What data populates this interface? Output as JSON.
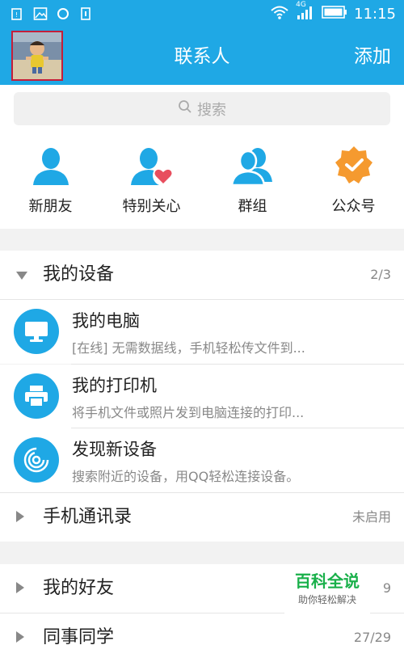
{
  "status_bar": {
    "time": "11:15",
    "network": "4G"
  },
  "header": {
    "title": "联系人",
    "add_label": "添加"
  },
  "search": {
    "placeholder": "搜索"
  },
  "shortcuts": [
    {
      "label": "新朋友",
      "icon": "person-icon"
    },
    {
      "label": "特别关心",
      "icon": "person-heart-icon"
    },
    {
      "label": "群组",
      "icon": "group-icon"
    },
    {
      "label": "公众号",
      "icon": "verified-badge-icon"
    }
  ],
  "groups": {
    "my_devices": {
      "name": "我的设备",
      "count": "2/3"
    },
    "phone_contacts": {
      "name": "手机通讯录",
      "count": "未启用"
    },
    "my_friends": {
      "name": "我的好友",
      "count": "9"
    },
    "colleagues": {
      "name": "同事同学",
      "count": "27/29"
    }
  },
  "devices": [
    {
      "name": "我的电脑",
      "desc": "[在线] 无需数据线，手机轻松传文件到...",
      "icon": "monitor-icon"
    },
    {
      "name": "我的打印机",
      "desc": "将手机文件或照片发到电脑连接的打印...",
      "icon": "printer-icon"
    },
    {
      "name": "发现新设备",
      "desc": "搜索附近的设备，用QQ轻松连接设备。",
      "icon": "radar-icon"
    }
  ],
  "watermark": {
    "title": "百科全说",
    "subtitle": "助你轻松解决"
  },
  "colors": {
    "primary": "#1fa8e5",
    "badge_orange": "#f59a2f",
    "heart_red": "#e84e5e"
  }
}
